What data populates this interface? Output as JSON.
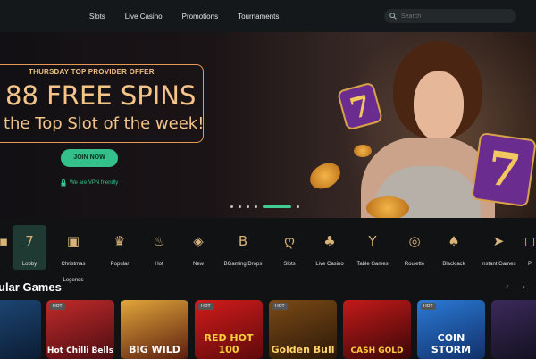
{
  "header": {
    "nav": [
      "Slots",
      "Live Casino",
      "Promotions",
      "Tournaments"
    ],
    "search_placeholder": "Search"
  },
  "hero": {
    "label": "THURSDAY TOP PROVIDER OFFER",
    "title": "88 FREE SPINS",
    "subtitle": "the Top Slot of the week!",
    "cta": "JOIN NOW",
    "vpn_text": "We are VPN friendly",
    "slides_total": 6,
    "active_slide": 4
  },
  "categories": [
    {
      "label": "",
      "icon": "partial-icon"
    },
    {
      "label": "Lobby",
      "icon": "seven-icon"
    },
    {
      "label": "Christmas Legends",
      "icon": "gift-icon"
    },
    {
      "label": "Popular",
      "icon": "crown-icon"
    },
    {
      "label": "Hot",
      "icon": "flame-icon"
    },
    {
      "label": "New",
      "icon": "tag-icon"
    },
    {
      "label": "BGaming Drops",
      "icon": "b-icon"
    },
    {
      "label": "Slots",
      "icon": "cherry-icon"
    },
    {
      "label": "Live Casino",
      "icon": "club-icon"
    },
    {
      "label": "Table Games",
      "icon": "cocktail-icon"
    },
    {
      "label": "Roulette",
      "icon": "roulette-icon"
    },
    {
      "label": "Blackjack",
      "icon": "cards-icon"
    },
    {
      "label": "Instant Games",
      "icon": "rocket-icon"
    },
    {
      "label": "P",
      "icon": "partial-icon"
    }
  ],
  "section": {
    "title": "ular Games",
    "prev": "‹",
    "next": "›"
  },
  "games": [
    {
      "badge": "",
      "name": ""
    },
    {
      "badge": "HOT",
      "name": "Hot Chilli Bells"
    },
    {
      "badge": "",
      "name": "BIG WILD"
    },
    {
      "badge": "HOT",
      "name": "RED HOT 100"
    },
    {
      "badge": "HOT",
      "name": "Golden Bull"
    },
    {
      "badge": "",
      "name": "CASH GOLD"
    },
    {
      "badge": "HOT",
      "name": "COIN STORM"
    },
    {
      "badge": "",
      "name": ""
    }
  ],
  "colors": {
    "accent": "#33c08a",
    "gold": "#f5c488",
    "bg": "#101214"
  }
}
